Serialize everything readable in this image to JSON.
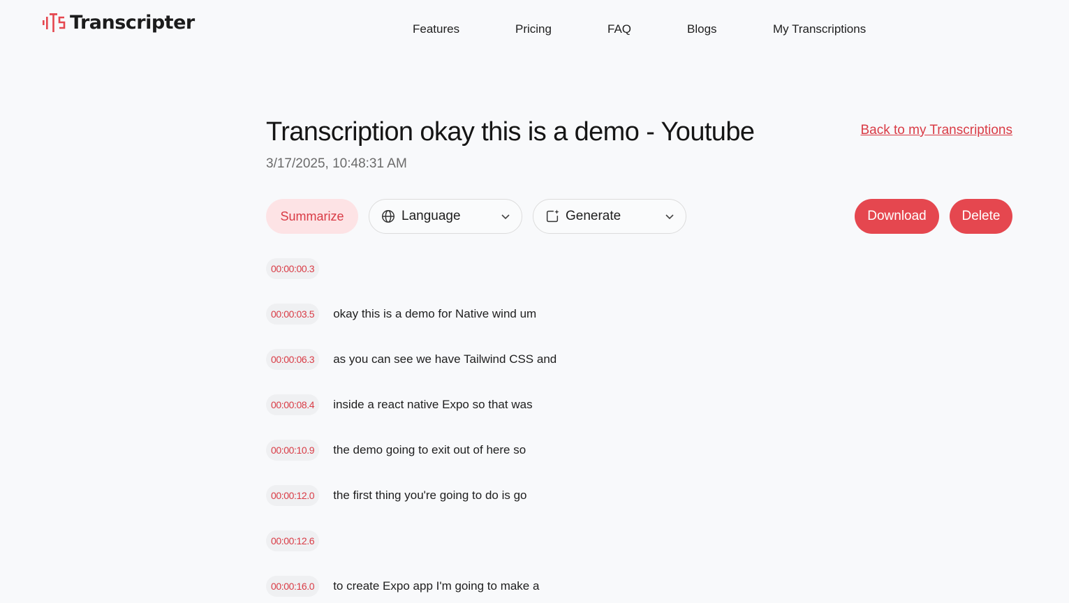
{
  "brand": {
    "name": "Transcripter",
    "accent": "#e5474f"
  },
  "nav": {
    "items": [
      {
        "label": "Features"
      },
      {
        "label": "Pricing"
      },
      {
        "label": "FAQ"
      },
      {
        "label": "Blogs"
      },
      {
        "label": "My Transcriptions"
      }
    ]
  },
  "page": {
    "title": "Transcription okay this is a demo - Youtube",
    "date": "3/17/2025, 10:48:31 AM",
    "back_link": "Back to my Transcriptions"
  },
  "toolbar": {
    "summarize": "Summarize",
    "language": {
      "label": "Language",
      "icon": "globe-icon"
    },
    "generate": {
      "label": "Generate",
      "icon": "sparkle-icon"
    },
    "download": "Download",
    "delete": "Delete"
  },
  "segments": [
    {
      "time": "00:00:00.3",
      "text": ""
    },
    {
      "time": "00:00:03.5",
      "text": "okay this is a demo for Native wind um"
    },
    {
      "time": "00:00:06.3",
      "text": "as you can see we have Tailwind CSS and"
    },
    {
      "time": "00:00:08.4",
      "text": "inside a react native Expo so that was"
    },
    {
      "time": "00:00:10.9",
      "text": "the demo going to exit out of here so"
    },
    {
      "time": "00:00:12.0",
      "text": "the first thing you're going to do is go"
    },
    {
      "time": "00:00:12.6",
      "text": ""
    },
    {
      "time": "00:00:16.0",
      "text": "to create Expo app I'm going to make a"
    }
  ]
}
